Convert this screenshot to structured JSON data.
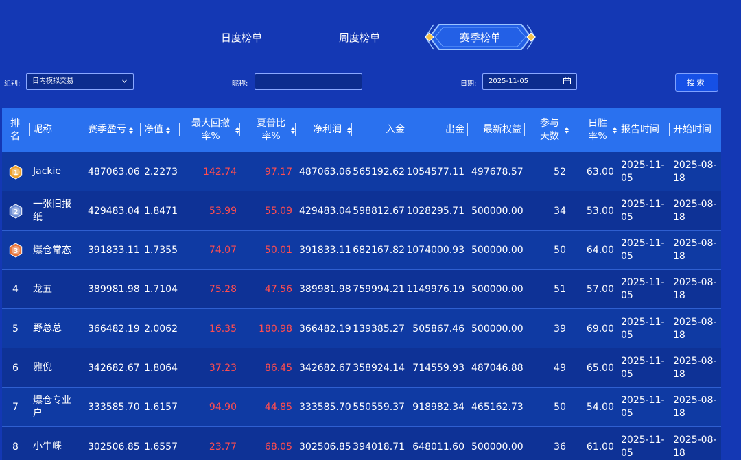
{
  "tabs": {
    "daily": "日度榜单",
    "weekly": "周度榜单",
    "season": "赛季榜单"
  },
  "filters": {
    "group_label": "组别:",
    "group_value": "日内模拟交易",
    "nickname_label": "昵称:",
    "nickname_value": "",
    "date_label": "日期:",
    "date_value": "2025-11-05",
    "search_label": "搜索"
  },
  "columns": [
    {
      "key": "rank",
      "label": "排\n名",
      "sortable": false
    },
    {
      "key": "nickname",
      "label": "昵称",
      "sortable": false
    },
    {
      "key": "season_pnl",
      "label": "赛季盈亏",
      "sortable": true
    },
    {
      "key": "nav",
      "label": "净值",
      "sortable": true
    },
    {
      "key": "max_drawdown",
      "label": "最大回撤\n率%",
      "sortable": true
    },
    {
      "key": "sharpe",
      "label": "夏普比\n率%",
      "sortable": true
    },
    {
      "key": "net_profit",
      "label": "净利润",
      "sortable": true
    },
    {
      "key": "deposit",
      "label": "入金",
      "sortable": false
    },
    {
      "key": "withdrawal",
      "label": "出金",
      "sortable": false
    },
    {
      "key": "latest_equity",
      "label": "最新权益",
      "sortable": false
    },
    {
      "key": "days",
      "label": "参与\n天数",
      "sortable": true
    },
    {
      "key": "win_rate",
      "label": "日胜\n率%",
      "sortable": true
    },
    {
      "key": "report_time",
      "label": "报告时间",
      "sortable": false
    },
    {
      "key": "start_time",
      "label": "开始时间",
      "sortable": false
    }
  ],
  "rows": [
    {
      "rank": "1",
      "medal": "gold",
      "nickname": "Jackie",
      "season_pnl": "487063.06",
      "nav": "2.2273",
      "max_drawdown": "142.74",
      "sharpe": "97.17",
      "net_profit": "487063.06",
      "deposit": "565192.62",
      "withdrawal": "1054577.11",
      "latest_equity": "497678.57",
      "days": "52",
      "win_rate": "63.00",
      "report_time": "2025-11-05",
      "start_time": "2025-08-18"
    },
    {
      "rank": "2",
      "medal": "silver",
      "nickname": "一张旧报纸",
      "season_pnl": "429483.04",
      "nav": "1.8471",
      "max_drawdown": "53.99",
      "sharpe": "55.09",
      "net_profit": "429483.04",
      "deposit": "598812.67",
      "withdrawal": "1028295.71",
      "latest_equity": "500000.00",
      "days": "34",
      "win_rate": "53.00",
      "report_time": "2025-11-05",
      "start_time": "2025-08-18"
    },
    {
      "rank": "3",
      "medal": "bronze",
      "nickname": "爆仓常态",
      "season_pnl": "391833.11",
      "nav": "1.7355",
      "max_drawdown": "74.07",
      "sharpe": "50.01",
      "net_profit": "391833.11",
      "deposit": "682167.82",
      "withdrawal": "1074000.93",
      "latest_equity": "500000.00",
      "days": "50",
      "win_rate": "64.00",
      "report_time": "2025-11-05",
      "start_time": "2025-08-18"
    },
    {
      "rank": "4",
      "medal": "",
      "nickname": "龙五",
      "season_pnl": "389981.98",
      "nav": "1.7104",
      "max_drawdown": "75.28",
      "sharpe": "47.56",
      "net_profit": "389981.98",
      "deposit": "759994.21",
      "withdrawal": "1149976.19",
      "latest_equity": "500000.00",
      "days": "51",
      "win_rate": "57.00",
      "report_time": "2025-11-05",
      "start_time": "2025-08-18"
    },
    {
      "rank": "5",
      "medal": "",
      "nickname": "野总总",
      "season_pnl": "366482.19",
      "nav": "2.0062",
      "max_drawdown": "16.35",
      "sharpe": "180.98",
      "net_profit": "366482.19",
      "deposit": "139385.27",
      "withdrawal": "505867.46",
      "latest_equity": "500000.00",
      "days": "39",
      "win_rate": "69.00",
      "report_time": "2025-11-05",
      "start_time": "2025-08-18"
    },
    {
      "rank": "6",
      "medal": "",
      "nickname": "雅倪",
      "season_pnl": "342682.67",
      "nav": "1.8064",
      "max_drawdown": "37.23",
      "sharpe": "86.45",
      "net_profit": "342682.67",
      "deposit": "358924.14",
      "withdrawal": "714559.93",
      "latest_equity": "487046.88",
      "days": "49",
      "win_rate": "65.00",
      "report_time": "2025-11-05",
      "start_time": "2025-08-18"
    },
    {
      "rank": "7",
      "medal": "",
      "nickname": "爆仓专业户",
      "season_pnl": "333585.70",
      "nav": "1.6157",
      "max_drawdown": "94.90",
      "sharpe": "44.85",
      "net_profit": "333585.70",
      "deposit": "550559.37",
      "withdrawal": "918982.34",
      "latest_equity": "465162.73",
      "days": "50",
      "win_rate": "54.00",
      "report_time": "2025-11-05",
      "start_time": "2025-08-18"
    },
    {
      "rank": "8",
      "medal": "",
      "nickname": "小牛崃",
      "season_pnl": "302506.85",
      "nav": "1.6557",
      "max_drawdown": "23.77",
      "sharpe": "68.05",
      "net_profit": "302506.85",
      "deposit": "394018.71",
      "withdrawal": "648011.60",
      "latest_equity": "500000.00",
      "days": "36",
      "win_rate": "61.00",
      "report_time": "2025-11-05",
      "start_time": "2025-08-18"
    }
  ],
  "colors": {
    "background": "#1438b4",
    "header_bg": "#2a71ef",
    "row_bg": "#0f3aa3",
    "negative_metric": "#ff4d4f",
    "medal_gold": "#f0a22b",
    "medal_silver": "#6f8fd6",
    "medal_bronze": "#e8743a"
  },
  "icons": {
    "group_select": "chevron-down-icon",
    "date_input": "calendar-icon",
    "sort": "sort-arrows-icon",
    "medals": [
      "gold-medal-icon",
      "silver-medal-icon",
      "bronze-medal-icon"
    ]
  }
}
